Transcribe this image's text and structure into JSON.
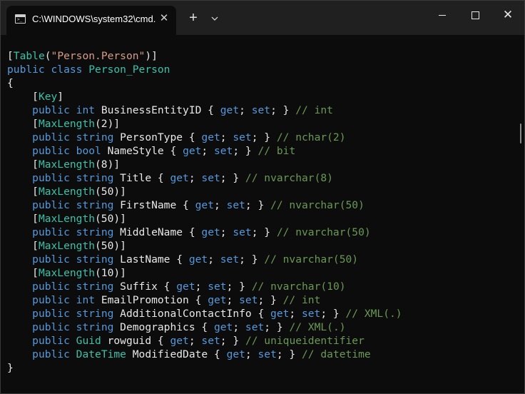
{
  "window": {
    "tab_title": "C:\\WINDOWS\\system32\\cmd.",
    "tab_close": "✕",
    "new_tab": "+",
    "dropdown": "⌄",
    "minimize": "",
    "maximize": "",
    "close": "✕"
  },
  "code_lines": [
    [
      {
        "t": "[",
        "c": "pl"
      },
      {
        "t": "Table",
        "c": "ty"
      },
      {
        "t": "(",
        "c": "pl"
      },
      {
        "t": "\"Person.Person\"",
        "c": "str"
      },
      {
        "t": ")]",
        "c": "pl"
      }
    ],
    [
      {
        "t": "public",
        "c": "kw"
      },
      {
        "t": " ",
        "c": "pl"
      },
      {
        "t": "class",
        "c": "kw"
      },
      {
        "t": " ",
        "c": "pl"
      },
      {
        "t": "Person_Person",
        "c": "ty"
      }
    ],
    [
      {
        "t": "{",
        "c": "pl"
      }
    ],
    [
      {
        "t": "    [",
        "c": "pl"
      },
      {
        "t": "Key",
        "c": "ty"
      },
      {
        "t": "]",
        "c": "pl"
      }
    ],
    [
      {
        "t": "    ",
        "c": "pl"
      },
      {
        "t": "public",
        "c": "kw"
      },
      {
        "t": " ",
        "c": "pl"
      },
      {
        "t": "int",
        "c": "kw"
      },
      {
        "t": " BusinessEntityID { ",
        "c": "pl"
      },
      {
        "t": "get",
        "c": "kw"
      },
      {
        "t": "; ",
        "c": "pl"
      },
      {
        "t": "set",
        "c": "kw"
      },
      {
        "t": "; } ",
        "c": "pl"
      },
      {
        "t": "// int",
        "c": "cm"
      }
    ],
    [
      {
        "t": "    [",
        "c": "pl"
      },
      {
        "t": "MaxLength",
        "c": "ty"
      },
      {
        "t": "(2)]",
        "c": "pl"
      }
    ],
    [
      {
        "t": "    ",
        "c": "pl"
      },
      {
        "t": "public",
        "c": "kw"
      },
      {
        "t": " ",
        "c": "pl"
      },
      {
        "t": "string",
        "c": "kw"
      },
      {
        "t": " PersonType { ",
        "c": "pl"
      },
      {
        "t": "get",
        "c": "kw"
      },
      {
        "t": "; ",
        "c": "pl"
      },
      {
        "t": "set",
        "c": "kw"
      },
      {
        "t": "; } ",
        "c": "pl"
      },
      {
        "t": "// nchar(2)",
        "c": "cm"
      }
    ],
    [
      {
        "t": "    ",
        "c": "pl"
      },
      {
        "t": "public",
        "c": "kw"
      },
      {
        "t": " ",
        "c": "pl"
      },
      {
        "t": "bool",
        "c": "kw"
      },
      {
        "t": " NameStyle { ",
        "c": "pl"
      },
      {
        "t": "get",
        "c": "kw"
      },
      {
        "t": "; ",
        "c": "pl"
      },
      {
        "t": "set",
        "c": "kw"
      },
      {
        "t": "; } ",
        "c": "pl"
      },
      {
        "t": "// bit",
        "c": "cm"
      }
    ],
    [
      {
        "t": "    [",
        "c": "pl"
      },
      {
        "t": "MaxLength",
        "c": "ty"
      },
      {
        "t": "(8)]",
        "c": "pl"
      }
    ],
    [
      {
        "t": "    ",
        "c": "pl"
      },
      {
        "t": "public",
        "c": "kw"
      },
      {
        "t": " ",
        "c": "pl"
      },
      {
        "t": "string",
        "c": "kw"
      },
      {
        "t": " Title { ",
        "c": "pl"
      },
      {
        "t": "get",
        "c": "kw"
      },
      {
        "t": "; ",
        "c": "pl"
      },
      {
        "t": "set",
        "c": "kw"
      },
      {
        "t": "; } ",
        "c": "pl"
      },
      {
        "t": "// nvarchar(8)",
        "c": "cm"
      }
    ],
    [
      {
        "t": "    [",
        "c": "pl"
      },
      {
        "t": "MaxLength",
        "c": "ty"
      },
      {
        "t": "(50)]",
        "c": "pl"
      }
    ],
    [
      {
        "t": "    ",
        "c": "pl"
      },
      {
        "t": "public",
        "c": "kw"
      },
      {
        "t": " ",
        "c": "pl"
      },
      {
        "t": "string",
        "c": "kw"
      },
      {
        "t": " FirstName { ",
        "c": "pl"
      },
      {
        "t": "get",
        "c": "kw"
      },
      {
        "t": "; ",
        "c": "pl"
      },
      {
        "t": "set",
        "c": "kw"
      },
      {
        "t": "; } ",
        "c": "pl"
      },
      {
        "t": "// nvarchar(50)",
        "c": "cm"
      }
    ],
    [
      {
        "t": "    [",
        "c": "pl"
      },
      {
        "t": "MaxLength",
        "c": "ty"
      },
      {
        "t": "(50)]",
        "c": "pl"
      }
    ],
    [
      {
        "t": "    ",
        "c": "pl"
      },
      {
        "t": "public",
        "c": "kw"
      },
      {
        "t": " ",
        "c": "pl"
      },
      {
        "t": "string",
        "c": "kw"
      },
      {
        "t": " MiddleName { ",
        "c": "pl"
      },
      {
        "t": "get",
        "c": "kw"
      },
      {
        "t": "; ",
        "c": "pl"
      },
      {
        "t": "set",
        "c": "kw"
      },
      {
        "t": "; } ",
        "c": "pl"
      },
      {
        "t": "// nvarchar(50)",
        "c": "cm"
      }
    ],
    [
      {
        "t": "    [",
        "c": "pl"
      },
      {
        "t": "MaxLength",
        "c": "ty"
      },
      {
        "t": "(50)]",
        "c": "pl"
      }
    ],
    [
      {
        "t": "    ",
        "c": "pl"
      },
      {
        "t": "public",
        "c": "kw"
      },
      {
        "t": " ",
        "c": "pl"
      },
      {
        "t": "string",
        "c": "kw"
      },
      {
        "t": " LastName { ",
        "c": "pl"
      },
      {
        "t": "get",
        "c": "kw"
      },
      {
        "t": "; ",
        "c": "pl"
      },
      {
        "t": "set",
        "c": "kw"
      },
      {
        "t": "; } ",
        "c": "pl"
      },
      {
        "t": "// nvarchar(50)",
        "c": "cm"
      }
    ],
    [
      {
        "t": "    [",
        "c": "pl"
      },
      {
        "t": "MaxLength",
        "c": "ty"
      },
      {
        "t": "(10)]",
        "c": "pl"
      }
    ],
    [
      {
        "t": "    ",
        "c": "pl"
      },
      {
        "t": "public",
        "c": "kw"
      },
      {
        "t": " ",
        "c": "pl"
      },
      {
        "t": "string",
        "c": "kw"
      },
      {
        "t": " Suffix { ",
        "c": "pl"
      },
      {
        "t": "get",
        "c": "kw"
      },
      {
        "t": "; ",
        "c": "pl"
      },
      {
        "t": "set",
        "c": "kw"
      },
      {
        "t": "; } ",
        "c": "pl"
      },
      {
        "t": "// nvarchar(10)",
        "c": "cm"
      }
    ],
    [
      {
        "t": "    ",
        "c": "pl"
      },
      {
        "t": "public",
        "c": "kw"
      },
      {
        "t": " ",
        "c": "pl"
      },
      {
        "t": "int",
        "c": "kw"
      },
      {
        "t": " EmailPromotion { ",
        "c": "pl"
      },
      {
        "t": "get",
        "c": "kw"
      },
      {
        "t": "; ",
        "c": "pl"
      },
      {
        "t": "set",
        "c": "kw"
      },
      {
        "t": "; } ",
        "c": "pl"
      },
      {
        "t": "// int",
        "c": "cm"
      }
    ],
    [
      {
        "t": "    ",
        "c": "pl"
      },
      {
        "t": "public",
        "c": "kw"
      },
      {
        "t": " ",
        "c": "pl"
      },
      {
        "t": "string",
        "c": "kw"
      },
      {
        "t": " AdditionalContactInfo { ",
        "c": "pl"
      },
      {
        "t": "get",
        "c": "kw"
      },
      {
        "t": "; ",
        "c": "pl"
      },
      {
        "t": "set",
        "c": "kw"
      },
      {
        "t": "; } ",
        "c": "pl"
      },
      {
        "t": "// XML(.)",
        "c": "cm"
      }
    ],
    [
      {
        "t": "    ",
        "c": "pl"
      },
      {
        "t": "public",
        "c": "kw"
      },
      {
        "t": " ",
        "c": "pl"
      },
      {
        "t": "string",
        "c": "kw"
      },
      {
        "t": " Demographics { ",
        "c": "pl"
      },
      {
        "t": "get",
        "c": "kw"
      },
      {
        "t": "; ",
        "c": "pl"
      },
      {
        "t": "set",
        "c": "kw"
      },
      {
        "t": "; } ",
        "c": "pl"
      },
      {
        "t": "// XML(.)",
        "c": "cm"
      }
    ],
    [
      {
        "t": "    ",
        "c": "pl"
      },
      {
        "t": "public",
        "c": "kw"
      },
      {
        "t": " ",
        "c": "pl"
      },
      {
        "t": "Guid",
        "c": "ty"
      },
      {
        "t": " rowguid { ",
        "c": "pl"
      },
      {
        "t": "get",
        "c": "kw"
      },
      {
        "t": "; ",
        "c": "pl"
      },
      {
        "t": "set",
        "c": "kw"
      },
      {
        "t": "; } ",
        "c": "pl"
      },
      {
        "t": "// uniqueidentifier",
        "c": "cm"
      }
    ],
    [
      {
        "t": "    ",
        "c": "pl"
      },
      {
        "t": "public",
        "c": "kw"
      },
      {
        "t": " ",
        "c": "pl"
      },
      {
        "t": "DateTime",
        "c": "ty"
      },
      {
        "t": " ModifiedDate { ",
        "c": "pl"
      },
      {
        "t": "get",
        "c": "kw"
      },
      {
        "t": "; ",
        "c": "pl"
      },
      {
        "t": "set",
        "c": "kw"
      },
      {
        "t": "; } ",
        "c": "pl"
      },
      {
        "t": "// datetime",
        "c": "cm"
      }
    ],
    [
      {
        "t": "}",
        "c": "pl"
      }
    ]
  ],
  "colors": {
    "background": "#0c0c0c",
    "titlebar": "#202020",
    "keyword": "#5599dd",
    "type": "#3bc1a9",
    "string": "#d69d85",
    "comment": "#6a9955",
    "text": "#e8e8e8"
  },
  "icons": {
    "tab_icon": "cmd-prompt-icon",
    "close": "close-icon",
    "plus": "plus-icon",
    "dropdown": "chevron-down-icon"
  }
}
